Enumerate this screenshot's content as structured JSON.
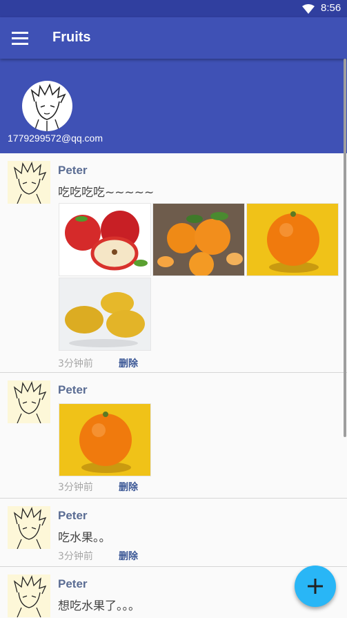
{
  "status": {
    "time": "8:56",
    "wifi_icon": "wifi-icon"
  },
  "toolbar": {
    "title": "Fruits",
    "menu_icon": "hamburger-menu-icon"
  },
  "header": {
    "email": "1779299572@qq.com",
    "avatar_icon": "user-avatar-icon"
  },
  "posts": [
    {
      "name": "Peter",
      "text": "吃吃吃吃~~~~~",
      "time": "3分钟前",
      "delete_label": "删除",
      "images": [
        "apple",
        "tangerines",
        "orange",
        "lemons"
      ]
    },
    {
      "name": "Peter",
      "text": "",
      "time": "3分钟前",
      "delete_label": "删除",
      "images": [
        "orange"
      ]
    },
    {
      "name": "Peter",
      "text": "吃水果。。",
      "time": "3分钟前",
      "delete_label": "删除",
      "images": []
    },
    {
      "name": "Peter",
      "text": "想吃水果了。。。",
      "time": "",
      "delete_label": "",
      "images": []
    }
  ],
  "fab": {
    "icon": "plus-icon"
  },
  "colors": {
    "primary": "#3f51b5",
    "primary_dark": "#303f9f",
    "accent": "#29b6f6",
    "name": "#5a6c93",
    "delete": "#3c5896"
  }
}
